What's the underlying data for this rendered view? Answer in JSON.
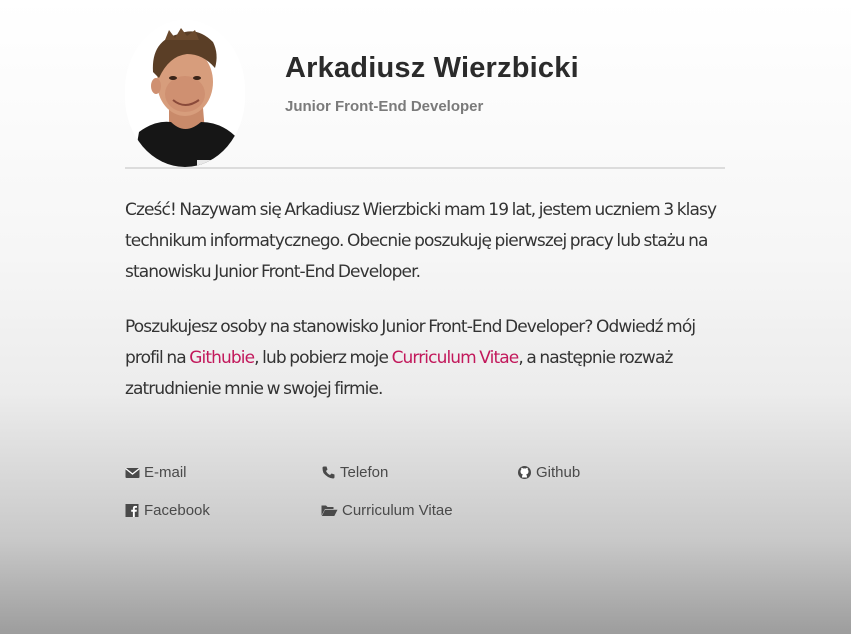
{
  "profile": {
    "name": "Arkadiusz Wierzbicki",
    "role": "Junior Front-End Developer"
  },
  "about": {
    "paragraph1": "Cześć! Nazywam się Arkadiusz Wierzbicki mam 19 lat, jestem uczniem 3 klasy technikum informatycznego. Obecnie poszukuję pierwszej pracy lub stażu na stanowisku Junior Front-End Developer.",
    "paragraph2_part1": "Poszukujesz osoby na stanowisko Junior Front-End Developer? Odwiedź mój profil na ",
    "github_link": "Githubie",
    "paragraph2_part2": ", lub pobierz moje ",
    "cv_link": "Curriculum Vitae",
    "paragraph2_part3": ", a następnie rozważ zatrudnienie mnie w swojej firmie."
  },
  "contacts": {
    "email": {
      "label": "E-mail",
      "icon": "envelope-icon"
    },
    "phone": {
      "label": "Telefon",
      "icon": "phone-icon"
    },
    "github": {
      "label": "Github",
      "icon": "github-icon"
    },
    "facebook": {
      "label": "Facebook",
      "icon": "facebook-icon"
    },
    "cv": {
      "label": "Curriculum Vitae",
      "icon": "folder-open-icon"
    }
  },
  "colors": {
    "accent_link": "#c2185b",
    "text": "#333333",
    "muted": "#7a7a7a",
    "divider": "#dcdcdc"
  }
}
